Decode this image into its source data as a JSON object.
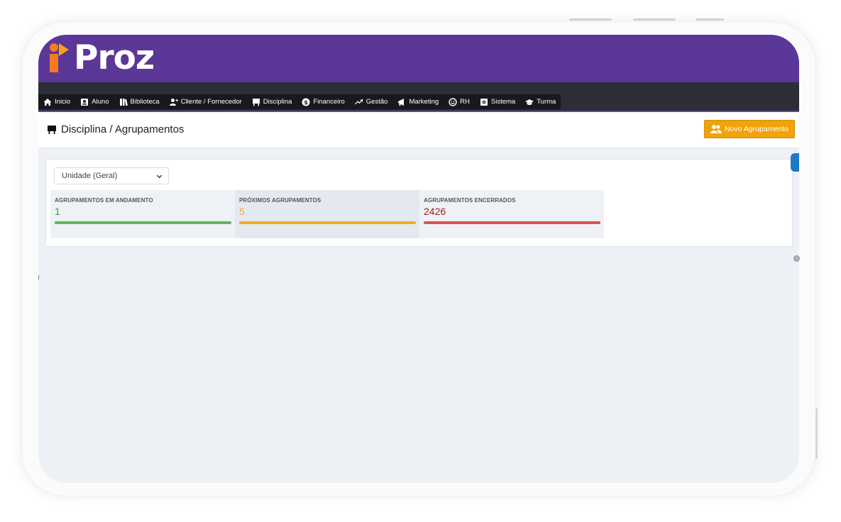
{
  "brand": {
    "name": "Proz"
  },
  "nav": {
    "items": [
      {
        "label": "Inicio",
        "icon": "home-icon"
      },
      {
        "label": "Aluno",
        "icon": "id-card-icon"
      },
      {
        "label": "Biblioteca",
        "icon": "books-icon"
      },
      {
        "label": "Cliente / Fornecedor",
        "icon": "user-plus-icon"
      },
      {
        "label": "Disciplina",
        "icon": "chalkboard-icon"
      },
      {
        "label": "Financeiro",
        "icon": "dollar-circle-icon"
      },
      {
        "label": "Gestão",
        "icon": "trend-icon"
      },
      {
        "label": "Marketing",
        "icon": "megaphone-icon"
      },
      {
        "label": "RH",
        "icon": "smiley-icon"
      },
      {
        "label": "Sistema",
        "icon": "gear-icon"
      },
      {
        "label": "Turma",
        "icon": "graduation-cap-icon"
      }
    ]
  },
  "page": {
    "title": "Disciplina / Agrupamentos",
    "title_icon": "chalkboard-icon",
    "new_button_label": "Novo Agrupamento",
    "new_button_icon": "users-icon"
  },
  "filters": {
    "unit_selected": "Unidade (Geral)"
  },
  "stats": [
    {
      "label": "AGRUPAMENTOS EM ANDAMENTO",
      "value": "1",
      "value_color": "#3e9a3e",
      "bar_color": "#5cb85c",
      "bg": "#eef1f5"
    },
    {
      "label": "PRÓXIMOS AGRUPAMENTOS",
      "value": "5",
      "value_color": "#f0ad4e",
      "bar_color": "#f0ad1e",
      "bg": "#e4e9f0"
    },
    {
      "label": "AGRUPAMENTOS ENCERRADOS",
      "value": "2426",
      "value_color": "#a12020",
      "bar_color": "#d9534f",
      "bg": "#eef1f5"
    }
  ],
  "colors": {
    "header": "#5b3797",
    "navbar": "#2c2d35",
    "accent": "#f0a30a"
  }
}
